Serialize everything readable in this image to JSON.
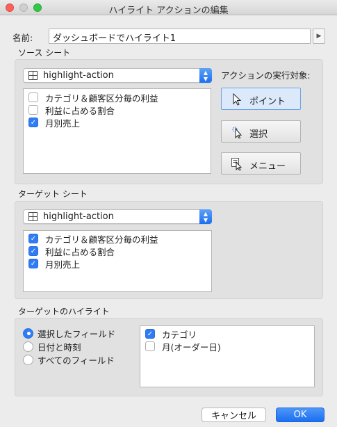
{
  "window": {
    "title": "ハイライト アクションの編集"
  },
  "name": {
    "label": "名前:",
    "value": "ダッシュボードでハイライト1",
    "insert_glyph": "▶"
  },
  "source": {
    "title": "ソース シート",
    "sheet": "highlight-action",
    "fields": [
      {
        "label": "カテゴリ＆顧客区分毎の利益",
        "checked": false
      },
      {
        "label": "利益に占める割合",
        "checked": false
      },
      {
        "label": "月別売上",
        "checked": true
      }
    ]
  },
  "action": {
    "label": "アクションの実行対象:",
    "buttons": [
      {
        "label": "ポイント",
        "icon": "pointer-icon",
        "selected": true
      },
      {
        "label": "選択",
        "icon": "select-cursor-icon",
        "selected": false
      },
      {
        "label": "メニュー",
        "icon": "menu-cursor-icon",
        "selected": false
      }
    ]
  },
  "target": {
    "title": "ターゲット シート",
    "sheet": "highlight-action",
    "fields": [
      {
        "label": "カテゴリ＆顧客区分毎の利益",
        "checked": true
      },
      {
        "label": "利益に占める割合",
        "checked": true
      },
      {
        "label": "月別売上",
        "checked": true
      }
    ]
  },
  "highlight": {
    "title": "ターゲットのハイライト",
    "options": [
      {
        "label": "選択したフィールド",
        "selected": true
      },
      {
        "label": "日付と時刻",
        "selected": false
      },
      {
        "label": "すべてのフィールド",
        "selected": false
      }
    ],
    "fields": [
      {
        "label": "カテゴリ",
        "checked": true
      },
      {
        "label": "月(オーダー日)",
        "checked": false
      }
    ]
  },
  "footer": {
    "cancel_label": "キャンセル",
    "ok_label": "OK"
  },
  "colors": {
    "accent": "#2f7cf6",
    "panel": "#e1e1e1",
    "window": "#ececec"
  }
}
